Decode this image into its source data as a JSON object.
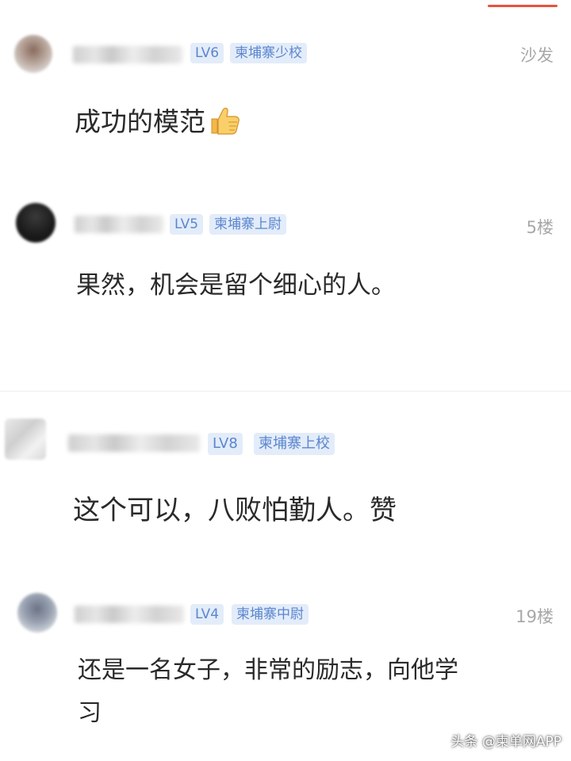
{
  "comments": [
    {
      "level": "LV6",
      "title": "柬埔寨少校",
      "floor": "沙发",
      "text": "成功的模范",
      "emoji": "thumbs-up-icon"
    },
    {
      "level": "LV5",
      "title": "柬埔寨上尉",
      "floor": "5楼",
      "text": "果然，机会是留个细心的人。"
    },
    {
      "level": "LV8",
      "title": "柬埔寨上校",
      "floor": "",
      "text": "这个可以，八败怕勤人。赞"
    },
    {
      "level": "LV4",
      "title": "柬埔寨中尉",
      "floor": "19楼",
      "text_line1": "还是一名女子，非常的励志，向他学",
      "text_line2": "习"
    }
  ],
  "watermark": "头条 @柬单网APP",
  "colors": {
    "accent_line": "#e8543d",
    "badge_bg": "#e3ecf9",
    "badge_text": "#5b86cf",
    "floor_text": "#a8a8a8",
    "body_text": "#2a2a2a"
  }
}
